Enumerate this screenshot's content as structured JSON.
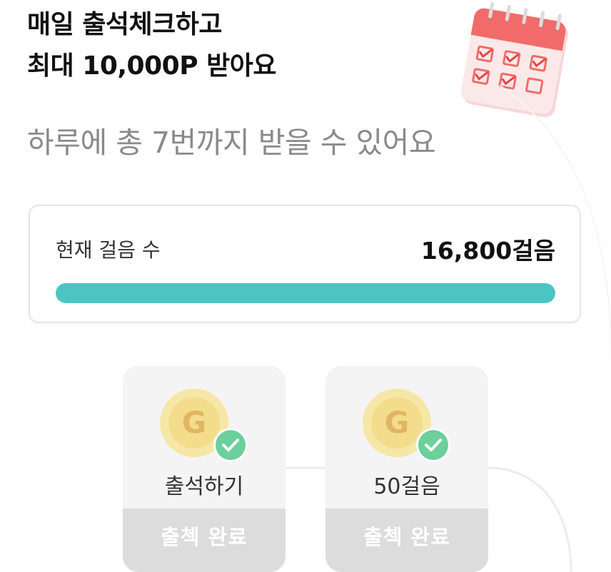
{
  "header": {
    "title_line1": "매일 출석체크하고",
    "title_line2": "최대 10,000P 받아요",
    "subtitle": "하루에 총 7번까지 받을 수 있어요",
    "illustration_icon": "calendar-checklist-icon"
  },
  "steps": {
    "label": "현재 걸음 수",
    "value": "16,800걸음",
    "progress": 1.0
  },
  "rewards": [
    {
      "label": "출석하기",
      "status": "출첵 완료",
      "coin_letter": "G",
      "completed": true
    },
    {
      "label": "50걸음",
      "status": "출첵 완료",
      "coin_letter": "G",
      "completed": true
    }
  ],
  "colors": {
    "accent": "#4cc4c4",
    "check": "#6ccf9c",
    "coin": "#f3dc8c",
    "coin_inner": "#e9c46a",
    "calendar": "#f26b6b"
  }
}
